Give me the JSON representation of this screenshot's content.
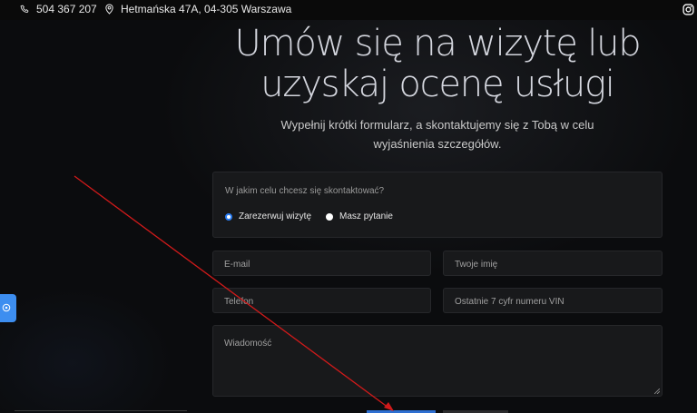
{
  "topbar": {
    "phone": "504 367 207",
    "address": "Hetmańska 47A, 04-305 Warszawa",
    "instagram_icon": "instagram-icon"
  },
  "hero": {
    "title_line1": "Umów się na wizytę lub",
    "title_line2": "uzyskaj ocenę usługi",
    "subtitle_line1": "Wypełnij krótki formularz, a skontaktujemy się z Tobą w celu",
    "subtitle_line2": "wyjaśnienia szczegółów."
  },
  "form": {
    "purpose_question": "W jakim celu chcesz się skontaktować?",
    "options": [
      {
        "label": "Zarezerwuj wizytę",
        "selected": true
      },
      {
        "label": "Masz pytanie",
        "selected": false
      }
    ],
    "email_placeholder": "E-mail",
    "name_placeholder": "Twoje imię",
    "phone_placeholder": "Telefon",
    "vin_placeholder": "Ostatnie 7 cyfr numeru VIN",
    "message_placeholder": "Wiadomość"
  },
  "colors": {
    "accent": "#2b7ef5",
    "background": "#0b0c0e",
    "panel": "#18191b",
    "annotation_arrow": "#d11a1a"
  }
}
